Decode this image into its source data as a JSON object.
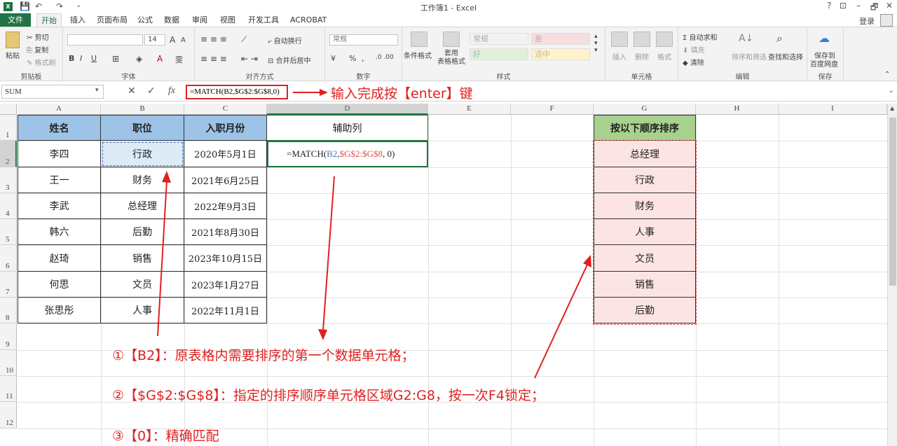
{
  "window": {
    "title": "工作簿1 - Excel",
    "help": "?",
    "restore_ribbon": "⊡",
    "minimize": "–",
    "maximize": "🗗",
    "close": "✕"
  },
  "quick_access": {
    "save": "💾",
    "undo": "↶",
    "redo": "↷",
    "more": "⌄"
  },
  "tabs": [
    {
      "label": "文件"
    },
    {
      "label": "开始"
    },
    {
      "label": "插入"
    },
    {
      "label": "页面布局"
    },
    {
      "label": "公式"
    },
    {
      "label": "数据"
    },
    {
      "label": "审阅"
    },
    {
      "label": "视图"
    },
    {
      "label": "开发工具"
    },
    {
      "label": "ACROBAT"
    }
  ],
  "account": {
    "login_label": "登录"
  },
  "ribbon": {
    "clipboard": {
      "paste": "粘贴",
      "cut": "剪切",
      "copy": "复制",
      "format_painter": "格式刷",
      "label": "剪贴板"
    },
    "font": {
      "size": "14",
      "bold": "B",
      "italic": "I",
      "underline": "U",
      "grow": "A",
      "shrink": "A",
      "phonetic": "雯",
      "label": "字体"
    },
    "alignment": {
      "wrap": "自动换行",
      "merge": "合并后居中",
      "label": "对齐方式"
    },
    "number": {
      "format": "常规",
      "percent": "%",
      "comma": ",",
      "label": "数字"
    },
    "styles": {
      "conditional": "条件格式",
      "table_format": "套用\n表格格式",
      "normal": "常规",
      "bad": "差",
      "good": "好",
      "neutral": "适中",
      "label": "样式"
    },
    "cells": {
      "insert": "插入",
      "delete": "删除",
      "format": "格式",
      "label": "单元格"
    },
    "editing": {
      "autosum": "自动求和",
      "fill": "填充",
      "clear": "清除",
      "sort_filter": "排序和筛选",
      "find_select": "查找和选择",
      "label": "编辑"
    },
    "save": {
      "save_to": "保存到",
      "baidu": "百度网盘",
      "label": "保存"
    }
  },
  "formula_bar": {
    "name_box": "SUM",
    "cancel": "✕",
    "enter": "✓",
    "fx": "fx",
    "formula": "=MATCH(B2,$G$2:$G$8,0)",
    "annotation": "输入完成按【enter】键"
  },
  "columns": [
    "A",
    "B",
    "C",
    "D",
    "E",
    "F",
    "G",
    "H",
    "I"
  ],
  "rows": [
    "1",
    "2",
    "3",
    "4",
    "5",
    "6",
    "7",
    "8",
    "9",
    "10",
    "11",
    "12"
  ],
  "table": {
    "headers": {
      "name": "姓名",
      "position": "职位",
      "date": "入职月份",
      "helper": "辅助列"
    },
    "rows": [
      {
        "name": "李四",
        "position": "行政",
        "date": "2020年5月1日"
      },
      {
        "name": "王一",
        "position": "财务",
        "date": "2021年6月25日"
      },
      {
        "name": "李武",
        "position": "总经理",
        "date": "2022年9月3日"
      },
      {
        "name": "韩六",
        "position": "后勤",
        "date": "2021年8月30日"
      },
      {
        "name": "赵琦",
        "position": "销售",
        "date": "2023年10月15日"
      },
      {
        "name": "何思",
        "position": "文员",
        "date": "2023年1月27日"
      },
      {
        "name": "张思彤",
        "position": "人事",
        "date": "2022年11月1日"
      }
    ],
    "formula_parts": {
      "prefix": "=MATCH(",
      "ref": "B2",
      "sep1": ", ",
      "range": "$G$2:$G$8",
      "suffix": ", 0)"
    }
  },
  "order_list": {
    "header": "按以下顺序排序",
    "items": [
      "总经理",
      "行政",
      "财务",
      "人事",
      "文员",
      "销售",
      "后勤"
    ]
  },
  "notes": [
    "①【B2】：原表格内需要排序的第一个数据单元格；",
    "②【$G$2:$G$8】：指定的排序顺序单元格区域G2:G8，按一次F4锁定；",
    "③【0】：精确匹配"
  ],
  "colors": {
    "excel_green": "#217346",
    "header_blue": "#9dc3e6",
    "header_green": "#a9d18e",
    "order_pink": "#fce4e4",
    "annotation_red": "#e02020"
  }
}
